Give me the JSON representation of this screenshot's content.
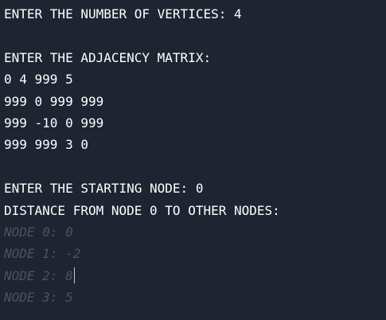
{
  "terminal": {
    "lines": [
      {
        "text": "ENTER THE NUMBER OF VERTICES: 4",
        "style": "normal"
      },
      {
        "text": "",
        "style": "normal"
      },
      {
        "text": "ENTER THE ADJACENCY MATRIX:",
        "style": "normal"
      },
      {
        "text": "0 4 999 5",
        "style": "normal"
      },
      {
        "text": "999 0 999 999",
        "style": "normal"
      },
      {
        "text": "999 -10 0 999",
        "style": "normal"
      },
      {
        "text": "999 999 3 0",
        "style": "normal"
      },
      {
        "text": "",
        "style": "normal"
      },
      {
        "text": "ENTER THE STARTING NODE: 0",
        "style": "normal"
      },
      {
        "text": "DISTANCE FROM NODE 0 TO OTHER NODES:",
        "style": "normal"
      },
      {
        "text": "NODE 0: 0",
        "style": "dim"
      },
      {
        "text": "NODE 1: -2",
        "style": "dim"
      },
      {
        "text": "NODE 2: 8",
        "style": "dim"
      },
      {
        "text": "NODE 3: 5",
        "style": "dim"
      }
    ]
  },
  "colors": {
    "background": "#1e2431",
    "text": "#ffffff",
    "dim_text": "#4b5263"
  }
}
